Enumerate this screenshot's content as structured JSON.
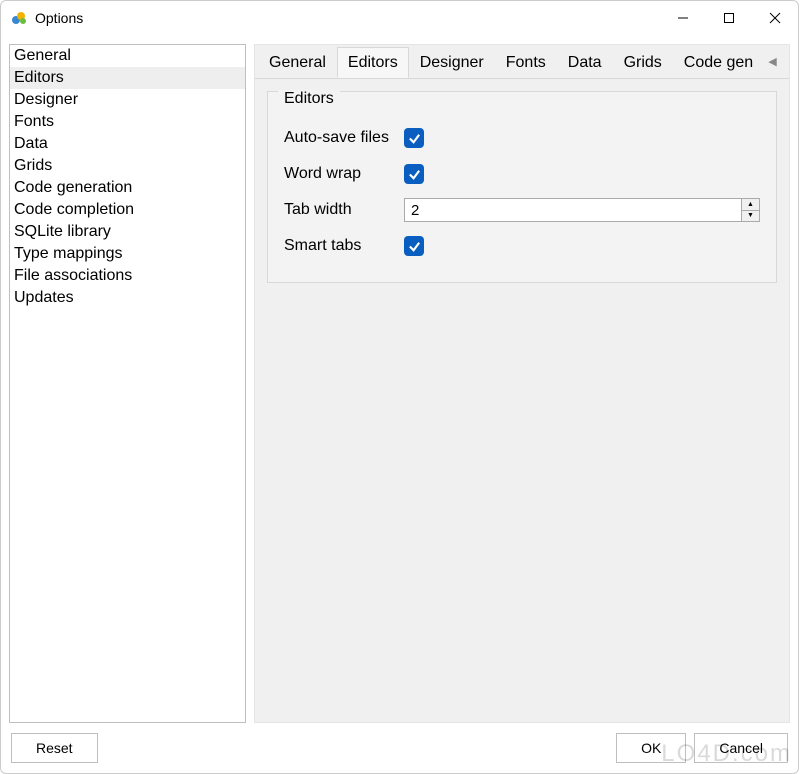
{
  "window": {
    "title": "Options"
  },
  "sidebar": {
    "items": [
      "General",
      "Editors",
      "Designer",
      "Fonts",
      "Data",
      "Grids",
      "Code generation",
      "Code completion",
      "SQLite library",
      "Type mappings",
      "File associations",
      "Updates"
    ],
    "selected_index": 1
  },
  "tabs": {
    "items": [
      "General",
      "Editors",
      "Designer",
      "Fonts",
      "Data",
      "Grids",
      "Code gen"
    ],
    "active_index": 1
  },
  "editors_panel": {
    "group_title": "Editors",
    "auto_save_label": "Auto-save files",
    "auto_save_checked": true,
    "word_wrap_label": "Word wrap",
    "word_wrap_checked": true,
    "tab_width_label": "Tab width",
    "tab_width_value": "2",
    "smart_tabs_label": "Smart tabs",
    "smart_tabs_checked": true
  },
  "buttons": {
    "reset": "Reset",
    "ok": "OK",
    "cancel": "Cancel"
  },
  "watermark": "LO4D.com"
}
